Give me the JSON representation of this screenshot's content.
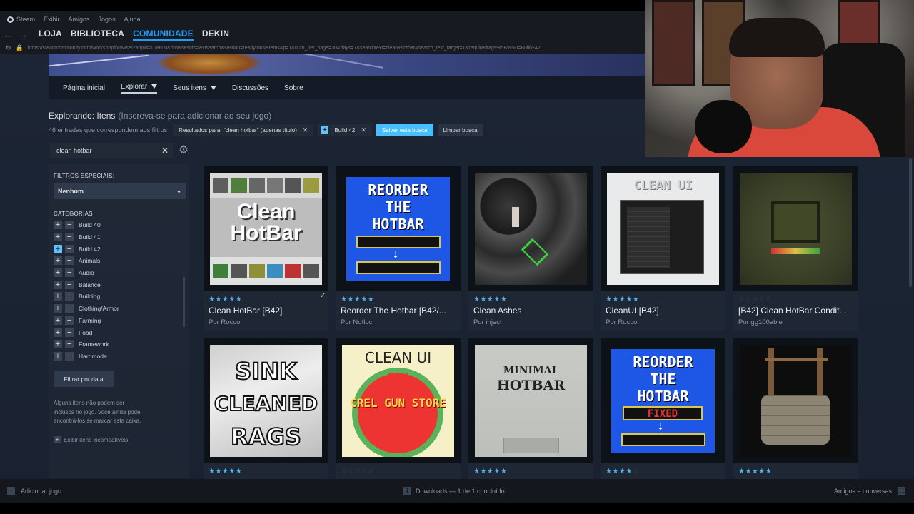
{
  "menu": {
    "items": [
      "Steam",
      "Exibir",
      "Amigos",
      "Jogos",
      "Ajuda"
    ]
  },
  "nav": {
    "links": [
      "LOJA",
      "BIBLIOTECA",
      "COMUNIDADE",
      "DEKIN"
    ],
    "active": "COMUNIDADE"
  },
  "url": "https://steamcommunity.com/workshop/browse/?appid=108600&browsesort=textsearch&section=readytouseitems&p=1&num_per_page=30&days=7&searchtext=clean+hotbar&search_text_target=1&requiredtags%5B%5D=Build+42",
  "subnav": {
    "home": "Página inicial",
    "explore": "Explorar",
    "your_items": "Seus itens",
    "discussions": "Discussões",
    "about": "Sobre"
  },
  "exploring": {
    "title": "Explorando: Itens",
    "hint": "(Inscreva-se para adicionar ao seu jogo)"
  },
  "filters": {
    "count": "46 entradas que correspondem aos filtros",
    "results_tag": "Resultados para: \"clean hotbar\" (apenas título)",
    "build_tag": "Build 42",
    "save_search": "Salvar esta busca",
    "clear_search": "Limpar busca"
  },
  "search": {
    "value": "clean hotbar"
  },
  "sidebar": {
    "special_title": "FILTROS ESPECIAIS:",
    "special_value": "Nenhum",
    "categories_title": "CATEGORIAS",
    "categories": [
      {
        "label": "Build 40",
        "on": false
      },
      {
        "label": "Build 41",
        "on": false
      },
      {
        "label": "Build 42",
        "on": true
      },
      {
        "label": "Animals",
        "on": false
      },
      {
        "label": "Audio",
        "on": false
      },
      {
        "label": "Balance",
        "on": false
      },
      {
        "label": "Building",
        "on": false
      },
      {
        "label": "Clothing/Armor",
        "on": false
      },
      {
        "label": "Farming",
        "on": false
      },
      {
        "label": "Food",
        "on": false
      },
      {
        "label": "Framework",
        "on": false
      },
      {
        "label": "Hardmode",
        "on": false
      }
    ],
    "date_button": "Filtrar por data",
    "note": "Alguns itens não podem ser inclusos no jogo. Você ainda pode encontrá-los se marcar esta caixa.",
    "incompat": "Exibir itens incompatíveis"
  },
  "items": [
    {
      "title": "Clean HotBar [B42]",
      "author": "Por Rocco",
      "rating": 5,
      "checked": true
    },
    {
      "title": "Reorder The Hotbar [B42/...",
      "author": "Por Notloc",
      "rating": 5
    },
    {
      "title": "Clean Ashes",
      "author": "Por inject",
      "rating": 5
    },
    {
      "title": "CleanUI [B42]",
      "author": "Por Rocco",
      "rating": 5
    },
    {
      "title": "[B42] Clean HotBar Condit...",
      "author": "Por gg100able",
      "rating": 0
    },
    {
      "title": "",
      "author": "",
      "rating": 5
    },
    {
      "title": "",
      "author": "",
      "rating": 0
    },
    {
      "title": "",
      "author": "",
      "rating": 5
    },
    {
      "title": "",
      "author": "",
      "rating": 4
    },
    {
      "title": "",
      "author": "",
      "rating": 5
    }
  ],
  "thumbs": {
    "t1": {
      "line1": "Clean",
      "line2": "HotBar"
    },
    "t2": {
      "line1": "REORDER",
      "line2": "THE",
      "line3": "HOTBAR"
    },
    "t4": {
      "title": "CLEAN UI"
    },
    "t6": {
      "line1": "SINK",
      "line2": "CLEANED",
      "line3": "RAGS"
    },
    "t7": {
      "line1": "CLEAN UI",
      "line2": "FIX",
      "line3": "CREL GUN STORE"
    },
    "t8": {
      "line1": "MINIMAL",
      "line2": "HOTBAR"
    },
    "t9": {
      "line1": "REORDER",
      "line2": "THE",
      "line3": "HOTBAR",
      "line4": "FIXED"
    }
  },
  "bottom": {
    "add_game": "Adicionar jogo",
    "downloads": "Downloads — 1 de 1 concluído",
    "friends": "Amigos e conversas"
  },
  "colors": {
    "accent": "#1a9fff",
    "star": "#4fb0e8",
    "save_button": "#47bfff"
  }
}
